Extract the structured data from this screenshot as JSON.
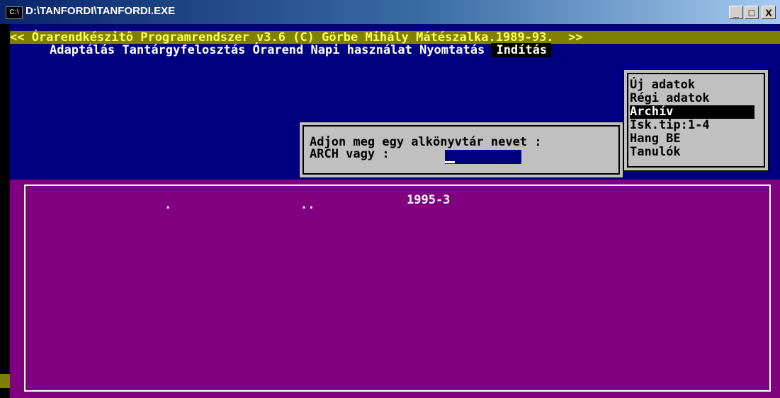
{
  "window": {
    "title": "D:\\TANFORDI\\TANFORDI.EXE",
    "icon": "console-icon",
    "buttons": {
      "minimize": "_",
      "maximize": "□",
      "close": "X"
    }
  },
  "header": {
    "text": "<< Órarendkészitô Programrendszer v3.6 (C) Görbe Mihály Mátészalka.1989-93.  >>"
  },
  "menu": {
    "items": [
      "Adaptálás",
      "Tantárgyfelosztás",
      "Órarend",
      "Napi használat",
      "Nyomtatás"
    ],
    "active": "Indítás"
  },
  "dropdown": {
    "items": [
      "Új adatok",
      "Régi adatok",
      "Archív",
      "Isk.tip:1-4",
      "Hang BE",
      "Tanulók"
    ],
    "selected": "Archív"
  },
  "dialog": {
    "line1": "Adjon meg egy alkönyvtár nevet :",
    "line2": "ARCH vagy :"
  },
  "directory_list": {
    "entries": [
      ".",
      "..",
      "1995-3"
    ]
  },
  "colors": {
    "background": "#000080",
    "header": "#808000",
    "header_text": "#ffff55",
    "panel": "#c0c0c0",
    "list_area": "#800080"
  }
}
